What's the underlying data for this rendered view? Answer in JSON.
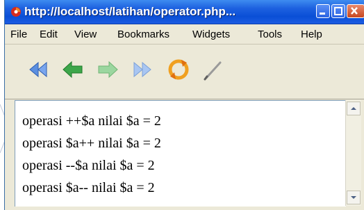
{
  "window": {
    "title": "http://localhost/latihan/operator.php..."
  },
  "menu": {
    "items": [
      "File",
      "Edit",
      "View",
      "Bookmarks",
      "Widgets",
      "Tools",
      "Help"
    ]
  },
  "toolbar": {
    "buttons": [
      "rewind-icon",
      "back-icon",
      "forward-icon",
      "fast-forward-icon",
      "reload-icon",
      "edit-icon"
    ]
  },
  "content": {
    "lines": [
      "operasi ++$a nilai $a = 2",
      "operasi $a++ nilai $a = 2",
      "operasi --$a nilai $a = 2",
      "operasi $a-- nilai $a = 2"
    ]
  },
  "colors": {
    "titlebar": "#0a4fd6",
    "chrome": "#ece9d8",
    "back_green": "#3da64a",
    "rewind_blue": "#4a7fd6",
    "reload_orange": "#f0a020"
  }
}
